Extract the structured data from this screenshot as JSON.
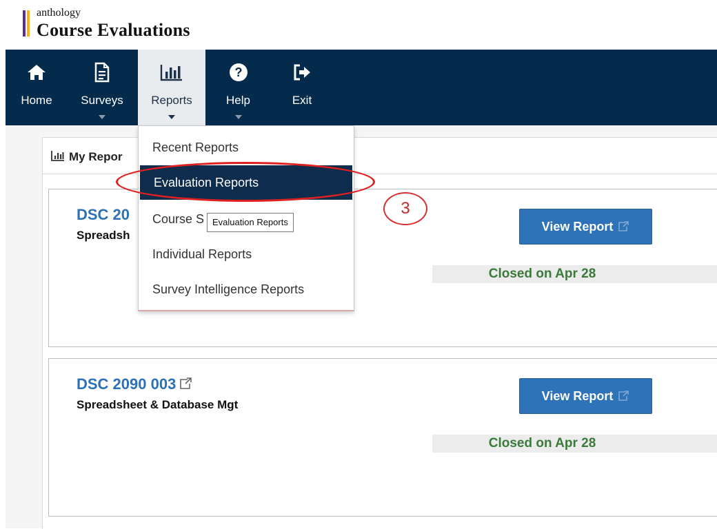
{
  "brand": {
    "small": "anthology",
    "title": "Course Evaluations",
    "colors": {
      "purple": "#5c2d91",
      "gold": "#f2b418"
    }
  },
  "nav": {
    "background": "#042b4b",
    "items": [
      {
        "label": "Home",
        "icon": "home-icon"
      },
      {
        "label": "Surveys",
        "icon": "document-icon"
      },
      {
        "label": "Reports",
        "icon": "bar-chart-icon",
        "active": true
      },
      {
        "label": "Help",
        "icon": "question-circle-icon"
      },
      {
        "label": "Exit",
        "icon": "exit-icon"
      }
    ]
  },
  "panel": {
    "title": "My Repor",
    "icon": "bar-chart-icon"
  },
  "dropdown": {
    "items": [
      "Recent Reports",
      "Evaluation Reports",
      "Course S",
      "Individual Reports",
      "Survey Intelligence Reports"
    ],
    "active": "Evaluation Reports"
  },
  "tooltip": "Evaluation Reports",
  "annotation": {
    "step": "3"
  },
  "cards": [
    {
      "code": "DSC 20",
      "name": "Spreadsh",
      "button": "View Report",
      "status": "Closed on Apr 28"
    },
    {
      "code": "DSC 2090 003",
      "name": "Spreadsheet & Database Mgt",
      "button": "View Report",
      "status": "Closed on Apr 28"
    }
  ]
}
